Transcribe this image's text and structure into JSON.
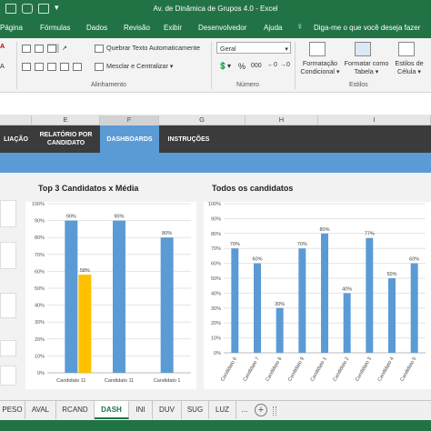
{
  "window": {
    "title": "Av. de Dinâmica de Grupos 4.0  -  Excel"
  },
  "menu": [
    "Página",
    "Fórmulas",
    "Dados",
    "Revisão",
    "Exibir",
    "Desenvolvedor",
    "Ajuda"
  ],
  "search": {
    "placeholder": "Diga-me o que você deseja fazer"
  },
  "ribbon": {
    "wrap_text": "Quebrar Texto Automaticamente",
    "merge_center": "Mesclar e Centralizar",
    "number_format": "Geral",
    "cond_format": [
      "Formatação",
      "Condicional"
    ],
    "format_table": [
      "Formatar como",
      "Tabela"
    ],
    "cell_styles": [
      "Estilos de",
      "Célula"
    ],
    "groups": {
      "alignment": "Alinhamento",
      "number": "Número",
      "styles": "Estilos"
    },
    "percent": "%",
    "thousands": "000"
  },
  "columns": [
    "E",
    "F",
    "G",
    "H",
    "I"
  ],
  "nav": {
    "avaliacao": "LIAÇÃO",
    "relatorio": [
      "RELATÓRIO POR",
      "CANDIDATO"
    ],
    "dashboards": "DASHBOARDS",
    "instrucoes": "INSTRUÇÕES"
  },
  "chart_data": [
    {
      "type": "bar",
      "title": "Top 3 Candidatos x Média",
      "categories": [
        "Candidato 11",
        "Candidato 11",
        "Candidato 1"
      ],
      "series": [
        {
          "values": [
            90,
            90,
            80
          ],
          "color": "#5b9bd5"
        },
        {
          "values": [
            58,
            null,
            null
          ],
          "color": "#ffc000"
        }
      ],
      "ylim": [
        0,
        100
      ],
      "yticks": [
        "0%",
        "10%",
        "20%",
        "30%",
        "40%",
        "50%",
        "60%",
        "70%",
        "80%",
        "90%",
        "100%"
      ]
    },
    {
      "type": "bar",
      "title": "Todos os candidatos",
      "categories": [
        "Candidato 6",
        "Candidato 7",
        "Candidato 8",
        "Candidato 9",
        "Candidato 1",
        "Candidato 2",
        "Candidato 3",
        "Candidato 4",
        "Candidato 5"
      ],
      "series": [
        {
          "values": [
            70,
            60,
            30,
            70,
            80,
            40,
            77,
            50,
            60
          ],
          "color": "#5b9bd5"
        }
      ],
      "ylim": [
        0,
        100
      ],
      "yticks": [
        "0%",
        "10%",
        "20%",
        "30%",
        "40%",
        "50%",
        "60%",
        "70%",
        "80%",
        "90%",
        "100%"
      ]
    }
  ],
  "sheets": [
    {
      "label": "PESO",
      "active": false
    },
    {
      "label": "AVAL",
      "active": false
    },
    {
      "label": "RCAND",
      "active": false
    },
    {
      "label": "DASH",
      "active": true
    },
    {
      "label": "INI",
      "active": false
    },
    {
      "label": "DUV",
      "active": false
    },
    {
      "label": "SUG",
      "active": false
    },
    {
      "label": "LUZ",
      "active": false
    }
  ],
  "add_sheet": "+"
}
